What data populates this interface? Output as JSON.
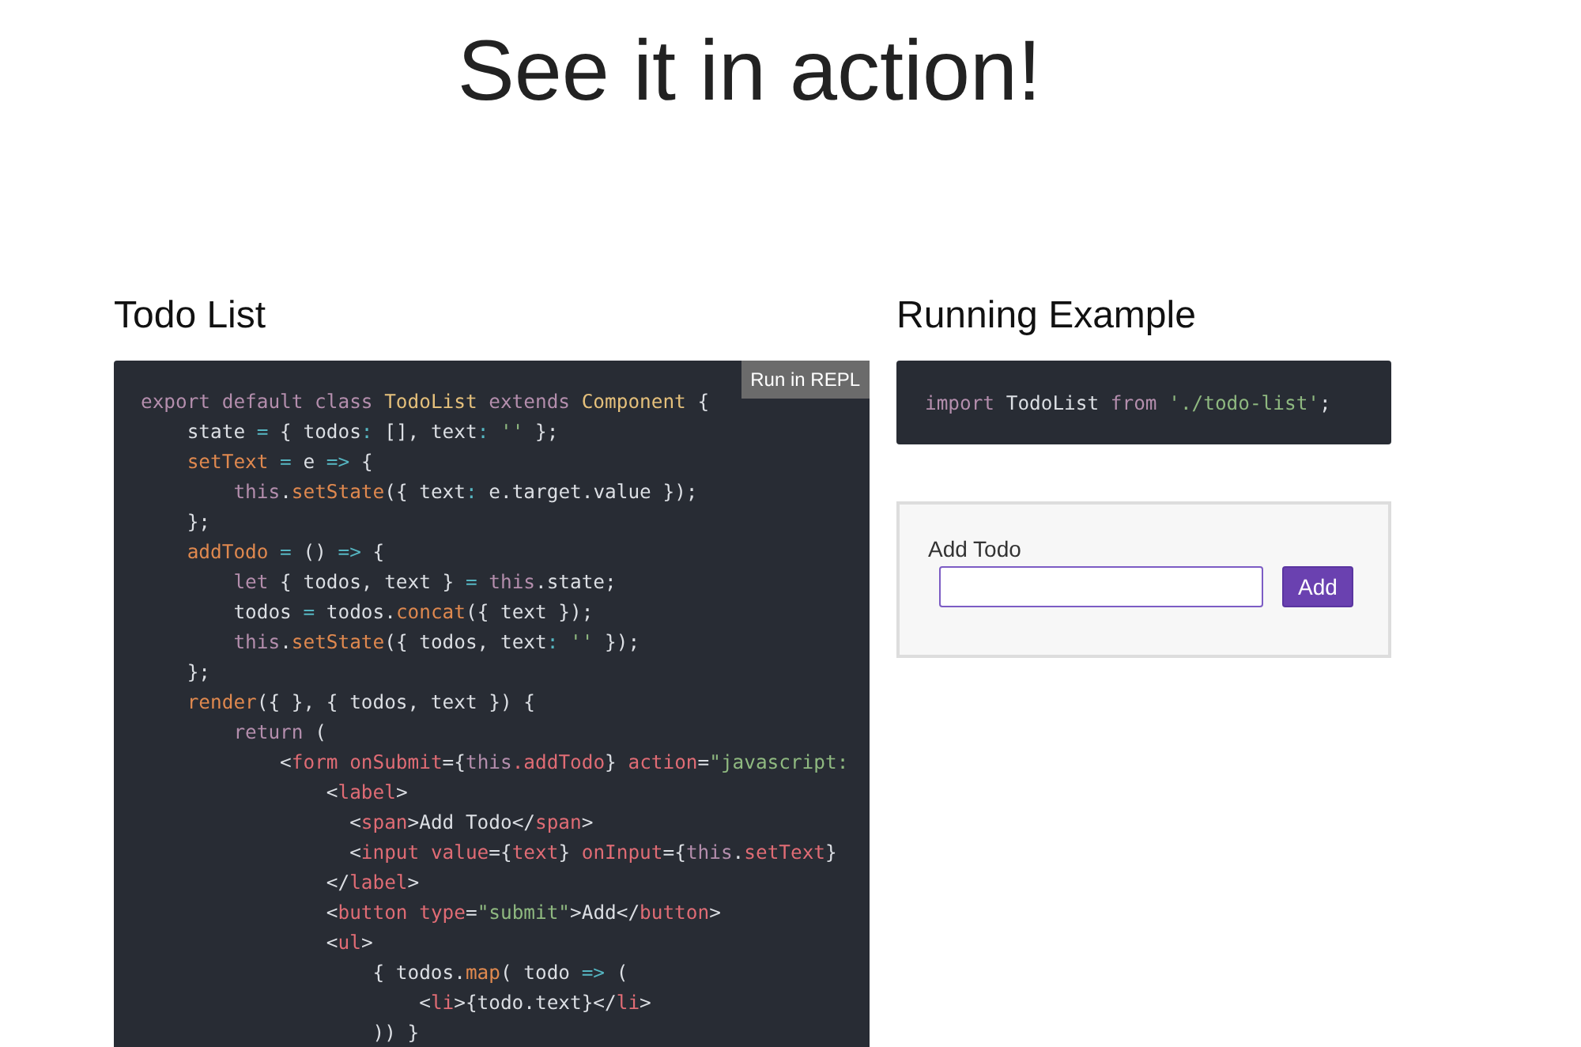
{
  "page_title": "See it in action!",
  "left": {
    "heading": "Todo List",
    "repl_button": "Run in REPL",
    "code": [
      [
        {
          "kind": "kw",
          "text": "export default class "
        },
        {
          "kind": "cls",
          "text": "TodoList"
        },
        {
          "kind": "kw",
          "text": " extends "
        },
        {
          "kind": "cls",
          "text": "Component"
        },
        {
          "kind": "plain",
          "text": " {"
        }
      ],
      [
        {
          "kind": "plain",
          "text": "    state "
        },
        {
          "kind": "op",
          "text": "="
        },
        {
          "kind": "plain",
          "text": " { todos"
        },
        {
          "kind": "op",
          "text": ":"
        },
        {
          "kind": "plain",
          "text": " [], text"
        },
        {
          "kind": "op",
          "text": ":"
        },
        {
          "kind": "str",
          "text": " ''"
        },
        {
          "kind": "plain",
          "text": " };"
        }
      ],
      [
        {
          "kind": "fn",
          "text": "    setText"
        },
        {
          "kind": "op",
          "text": " ="
        },
        {
          "kind": "plain",
          "text": " e "
        },
        {
          "kind": "op",
          "text": "=>"
        },
        {
          "kind": "plain",
          "text": " {"
        }
      ],
      [
        {
          "kind": "kw",
          "text": "        this"
        },
        {
          "kind": "plain",
          "text": "."
        },
        {
          "kind": "fn",
          "text": "setState"
        },
        {
          "kind": "plain",
          "text": "({ text"
        },
        {
          "kind": "op",
          "text": ":"
        },
        {
          "kind": "plain",
          "text": " e.target.value });"
        }
      ],
      [
        {
          "kind": "plain",
          "text": "    };"
        }
      ],
      [
        {
          "kind": "fn",
          "text": "    addTodo"
        },
        {
          "kind": "op",
          "text": " ="
        },
        {
          "kind": "plain",
          "text": " () "
        },
        {
          "kind": "op",
          "text": "=>"
        },
        {
          "kind": "plain",
          "text": " {"
        }
      ],
      [
        {
          "kind": "kw",
          "text": "        let"
        },
        {
          "kind": "plain",
          "text": " { todos, text } "
        },
        {
          "kind": "op",
          "text": "="
        },
        {
          "kind": "kw",
          "text": " this"
        },
        {
          "kind": "plain",
          "text": ".state;"
        }
      ],
      [
        {
          "kind": "plain",
          "text": "        todos "
        },
        {
          "kind": "op",
          "text": "="
        },
        {
          "kind": "plain",
          "text": " todos."
        },
        {
          "kind": "fn",
          "text": "concat"
        },
        {
          "kind": "plain",
          "text": "({ text });"
        }
      ],
      [
        {
          "kind": "kw",
          "text": "        this"
        },
        {
          "kind": "plain",
          "text": "."
        },
        {
          "kind": "fn",
          "text": "setState"
        },
        {
          "kind": "plain",
          "text": "({ todos, text"
        },
        {
          "kind": "op",
          "text": ":"
        },
        {
          "kind": "str",
          "text": " ''"
        },
        {
          "kind": "plain",
          "text": " });"
        }
      ],
      [
        {
          "kind": "plain",
          "text": "    };"
        }
      ],
      [
        {
          "kind": "fn",
          "text": "    render"
        },
        {
          "kind": "plain",
          "text": "({ }, { todos, text }) {"
        }
      ],
      [
        {
          "kind": "kw",
          "text": "        return"
        },
        {
          "kind": "plain",
          "text": " ("
        }
      ],
      [
        {
          "kind": "plain",
          "text": "            <"
        },
        {
          "kind": "tag",
          "text": "form"
        },
        {
          "kind": "tag",
          "text": " onSubmit"
        },
        {
          "kind": "plain",
          "text": "={"
        },
        {
          "kind": "kw",
          "text": "this"
        },
        {
          "kind": "tag",
          "text": ".addTodo"
        },
        {
          "kind": "plain",
          "text": "} "
        },
        {
          "kind": "tag",
          "text": "action"
        },
        {
          "kind": "plain",
          "text": "="
        },
        {
          "kind": "str",
          "text": "\"javascript:"
        }
      ],
      [
        {
          "kind": "plain",
          "text": "                <"
        },
        {
          "kind": "tag",
          "text": "label"
        },
        {
          "kind": "plain",
          "text": ">"
        }
      ],
      [
        {
          "kind": "plain",
          "text": "                  <"
        },
        {
          "kind": "tag",
          "text": "span"
        },
        {
          "kind": "plain",
          "text": ">Add Todo</"
        },
        {
          "kind": "tag",
          "text": "span"
        },
        {
          "kind": "plain",
          "text": ">"
        }
      ],
      [
        {
          "kind": "plain",
          "text": "                  <"
        },
        {
          "kind": "tag",
          "text": "input"
        },
        {
          "kind": "tag",
          "text": " value"
        },
        {
          "kind": "plain",
          "text": "={"
        },
        {
          "kind": "tag",
          "text": "text"
        },
        {
          "kind": "plain",
          "text": "} "
        },
        {
          "kind": "tag",
          "text": "onInput"
        },
        {
          "kind": "plain",
          "text": "={"
        },
        {
          "kind": "kw",
          "text": "this"
        },
        {
          "kind": "plain",
          "text": "."
        },
        {
          "kind": "tag",
          "text": "setText"
        },
        {
          "kind": "plain",
          "text": "}"
        }
      ],
      [
        {
          "kind": "plain",
          "text": "                </"
        },
        {
          "kind": "tag",
          "text": "label"
        },
        {
          "kind": "plain",
          "text": ">"
        }
      ],
      [
        {
          "kind": "plain",
          "text": "                <"
        },
        {
          "kind": "tag",
          "text": "button"
        },
        {
          "kind": "tag",
          "text": " type"
        },
        {
          "kind": "plain",
          "text": "="
        },
        {
          "kind": "str",
          "text": "\"submit\""
        },
        {
          "kind": "plain",
          "text": ">Add</"
        },
        {
          "kind": "tag",
          "text": "button"
        },
        {
          "kind": "plain",
          "text": ">"
        }
      ],
      [
        {
          "kind": "plain",
          "text": "                <"
        },
        {
          "kind": "tag",
          "text": "ul"
        },
        {
          "kind": "plain",
          "text": ">"
        }
      ],
      [
        {
          "kind": "plain",
          "text": "                    { todos."
        },
        {
          "kind": "fn",
          "text": "map"
        },
        {
          "kind": "plain",
          "text": "( todo "
        },
        {
          "kind": "op",
          "text": "=>"
        },
        {
          "kind": "plain",
          "text": " ("
        }
      ],
      [
        {
          "kind": "plain",
          "text": "                        <"
        },
        {
          "kind": "tag",
          "text": "li"
        },
        {
          "kind": "plain",
          "text": ">{todo.text}</"
        },
        {
          "kind": "tag",
          "text": "li"
        },
        {
          "kind": "plain",
          "text": ">"
        }
      ],
      [
        {
          "kind": "plain",
          "text": "                    )) }"
        }
      ]
    ]
  },
  "right": {
    "heading": "Running Example",
    "code": [
      [
        {
          "kind": "kw",
          "text": "import"
        },
        {
          "kind": "plain",
          "text": " TodoList "
        },
        {
          "kind": "kw",
          "text": "from"
        },
        {
          "kind": "str",
          "text": " './todo-list'"
        },
        {
          "kind": "plain",
          "text": ";"
        }
      ]
    ],
    "demo": {
      "label": "Add Todo",
      "button": "Add"
    }
  }
}
